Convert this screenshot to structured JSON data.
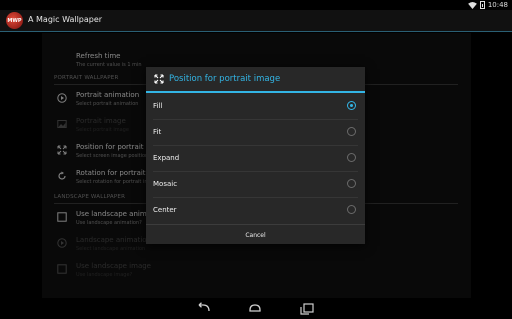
{
  "status_bar": {
    "time": "10:48"
  },
  "app": {
    "title": "A Magic Wallpaper",
    "logo_text": "MWP"
  },
  "settings": {
    "refresh": {
      "title": "Refresh time",
      "subtitle": "The current value is 1 min"
    },
    "portrait_header": "PORTRAIT WALLPAPER",
    "portrait_items": [
      {
        "title": "Portrait animation",
        "subtitle": "Select portrait animation",
        "icon": "play-icon",
        "enabled": true
      },
      {
        "title": "Portrait image",
        "subtitle": "Select portrait image",
        "icon": "image-icon",
        "enabled": false
      },
      {
        "title": "Position for portrait image",
        "subtitle": "Select screen image position",
        "icon": "expand-icon",
        "enabled": true
      },
      {
        "title": "Rotation for portrait image",
        "subtitle": "Select rotation for portrait image",
        "icon": "rotate-icon",
        "enabled": true
      }
    ],
    "landscape_header": "LANDSCAPE WALLPAPER",
    "landscape_items": [
      {
        "title": "Use landscape animation",
        "subtitle": "Use landscape animation?",
        "icon": "check-icon",
        "enabled": true
      },
      {
        "title": "Landscape animation",
        "subtitle": "Select landscape animation",
        "icon": "play-icon",
        "enabled": false
      },
      {
        "title": "Use landscape image",
        "subtitle": "Use landscape image?",
        "icon": "check-icon",
        "enabled": false
      }
    ]
  },
  "dialog": {
    "title": "Position for portrait image",
    "options": [
      {
        "label": "Fill",
        "checked": true
      },
      {
        "label": "Fit",
        "checked": false
      },
      {
        "label": "Expand",
        "checked": false
      },
      {
        "label": "Mosaic",
        "checked": false
      },
      {
        "label": "Center",
        "checked": false
      }
    ],
    "cancel_label": "Cancel"
  },
  "colors": {
    "accent": "#33b5e5",
    "dialog_bg": "#282828"
  }
}
